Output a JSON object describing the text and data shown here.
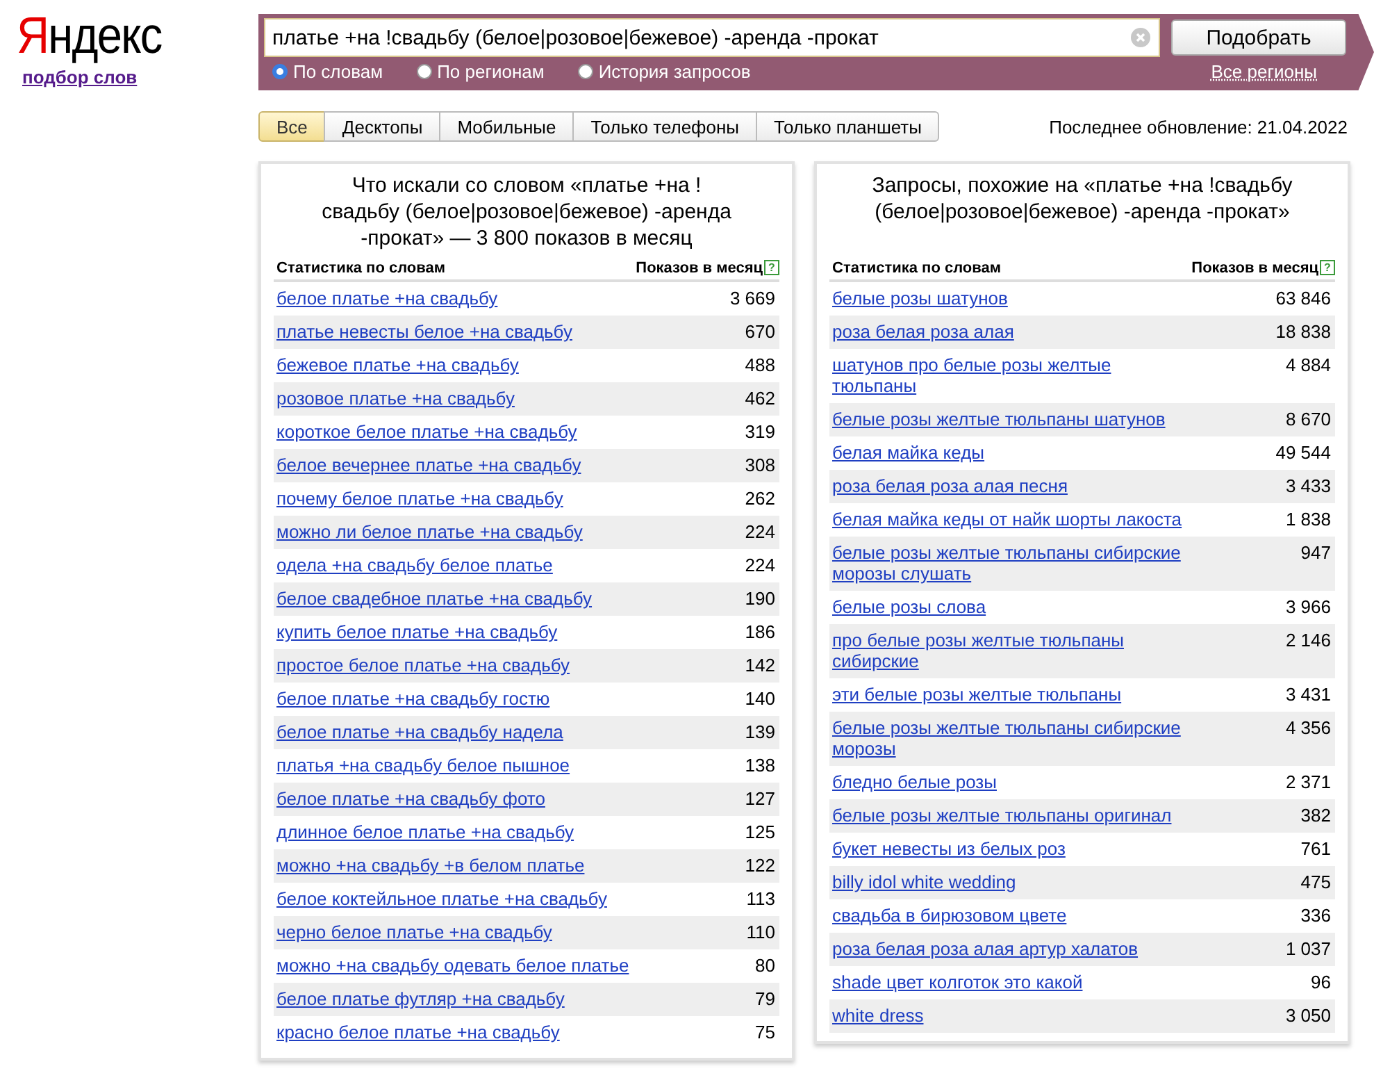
{
  "logo": {
    "text": "Яндекс",
    "link": "подбор слов"
  },
  "search": {
    "value": "платье +на !свадьбу (белое|розовое|бежевое) -аренда -прокат",
    "button": "Подобрать",
    "regions_link": "Все регионы",
    "modes": [
      {
        "label": "По словам",
        "selected": true
      },
      {
        "label": "По регионам",
        "selected": false
      },
      {
        "label": "История запросов",
        "selected": false
      }
    ]
  },
  "device_tabs": [
    {
      "label": "Все",
      "selected": true
    },
    {
      "label": "Десктопы",
      "selected": false
    },
    {
      "label": "Мобильные",
      "selected": false
    },
    {
      "label": "Только телефоны",
      "selected": false
    },
    {
      "label": "Только планшеты",
      "selected": false
    }
  ],
  "last_update": "Последнее обновление: 21.04.2022",
  "panels": [
    {
      "title": "Что искали со словом «платье +на !свадьбу (белое|розовое|бежевое) -аренда -прокат» — 3 800 показов в месяц",
      "col_word": "Статистика по словам",
      "col_count": "Показов в месяц",
      "help": "?",
      "rows": [
        {
          "phrase": "белое платье +на свадьбу",
          "count": "3 669"
        },
        {
          "phrase": "платье невесты белое +на свадьбу",
          "count": "670"
        },
        {
          "phrase": "бежевое платье +на свадьбу",
          "count": "488"
        },
        {
          "phrase": "розовое платье +на свадьбу",
          "count": "462"
        },
        {
          "phrase": "короткое белое платье +на свадьбу",
          "count": "319"
        },
        {
          "phrase": "белое вечернее платье +на свадьбу",
          "count": "308"
        },
        {
          "phrase": "почему белое платье +на свадьбу",
          "count": "262"
        },
        {
          "phrase": "можно ли белое платье +на свадьбу",
          "count": "224"
        },
        {
          "phrase": "одела +на свадьбу белое платье",
          "count": "224"
        },
        {
          "phrase": "белое свадебное платье +на свадьбу",
          "count": "190"
        },
        {
          "phrase": "купить белое платье +на свадьбу",
          "count": "186"
        },
        {
          "phrase": "простое белое платье +на свадьбу",
          "count": "142"
        },
        {
          "phrase": "белое платье +на свадьбу гостю",
          "count": "140"
        },
        {
          "phrase": "белое платье +на свадьбу надела",
          "count": "139"
        },
        {
          "phrase": "платья +на свадьбу белое пышное",
          "count": "138"
        },
        {
          "phrase": "белое платье +на свадьбу фото",
          "count": "127"
        },
        {
          "phrase": "длинное белое платье +на свадьбу",
          "count": "125"
        },
        {
          "phrase": "можно +на свадьбу +в белом платье",
          "count": "122"
        },
        {
          "phrase": "белое коктейльное платье +на свадьбу",
          "count": "113"
        },
        {
          "phrase": "черно белое платье +на свадьбу",
          "count": "110"
        },
        {
          "phrase": "можно +на свадьбу одевать белое платье",
          "count": "80"
        },
        {
          "phrase": "белое платье футляр +на свадьбу",
          "count": "79"
        },
        {
          "phrase": "красно белое платье +на свадьбу",
          "count": "75"
        }
      ]
    },
    {
      "title": "Запросы, похожие на «платье +на !свадьбу (белое|розовое|бежевое) -аренда -прокат»",
      "col_word": "Статистика по словам",
      "col_count": "Показов в месяц",
      "help": "?",
      "rows": [
        {
          "phrase": "белые розы шатунов",
          "count": "63 846"
        },
        {
          "phrase": "роза белая роза алая",
          "count": "18 838"
        },
        {
          "phrase": "шатунов про белые розы желтые тюльпаны",
          "count": "4 884"
        },
        {
          "phrase": "белые розы желтые тюльпаны шатунов",
          "count": "8 670"
        },
        {
          "phrase": "белая майка кеды",
          "count": "49 544"
        },
        {
          "phrase": "роза белая роза алая песня",
          "count": "3 433"
        },
        {
          "phrase": "белая майка кеды от найк шорты лакоста",
          "count": "1 838"
        },
        {
          "phrase": "белые розы желтые тюльпаны сибирские морозы слушать",
          "count": "947"
        },
        {
          "phrase": "белые розы слова",
          "count": "3 966"
        },
        {
          "phrase": "про белые розы желтые тюльпаны сибирские",
          "count": "2 146"
        },
        {
          "phrase": "эти белые розы желтые тюльпаны",
          "count": "3 431"
        },
        {
          "phrase": "белые розы желтые тюльпаны сибирские морозы",
          "count": "4 356"
        },
        {
          "phrase": "бледно белые розы",
          "count": "2 371"
        },
        {
          "phrase": "белые розы желтые тюльпаны оригинал",
          "count": "382"
        },
        {
          "phrase": "букет невесты из белых роз",
          "count": "761"
        },
        {
          "phrase": "billy idol white wedding",
          "count": "475"
        },
        {
          "phrase": "свадьба в бирюзовом цвете",
          "count": "336"
        },
        {
          "phrase": "роза белая роза алая артур халатов",
          "count": "1 037"
        },
        {
          "phrase": "shade цвет колготок это какой",
          "count": "96"
        },
        {
          "phrase": "white dress",
          "count": "3 050"
        }
      ]
    }
  ]
}
